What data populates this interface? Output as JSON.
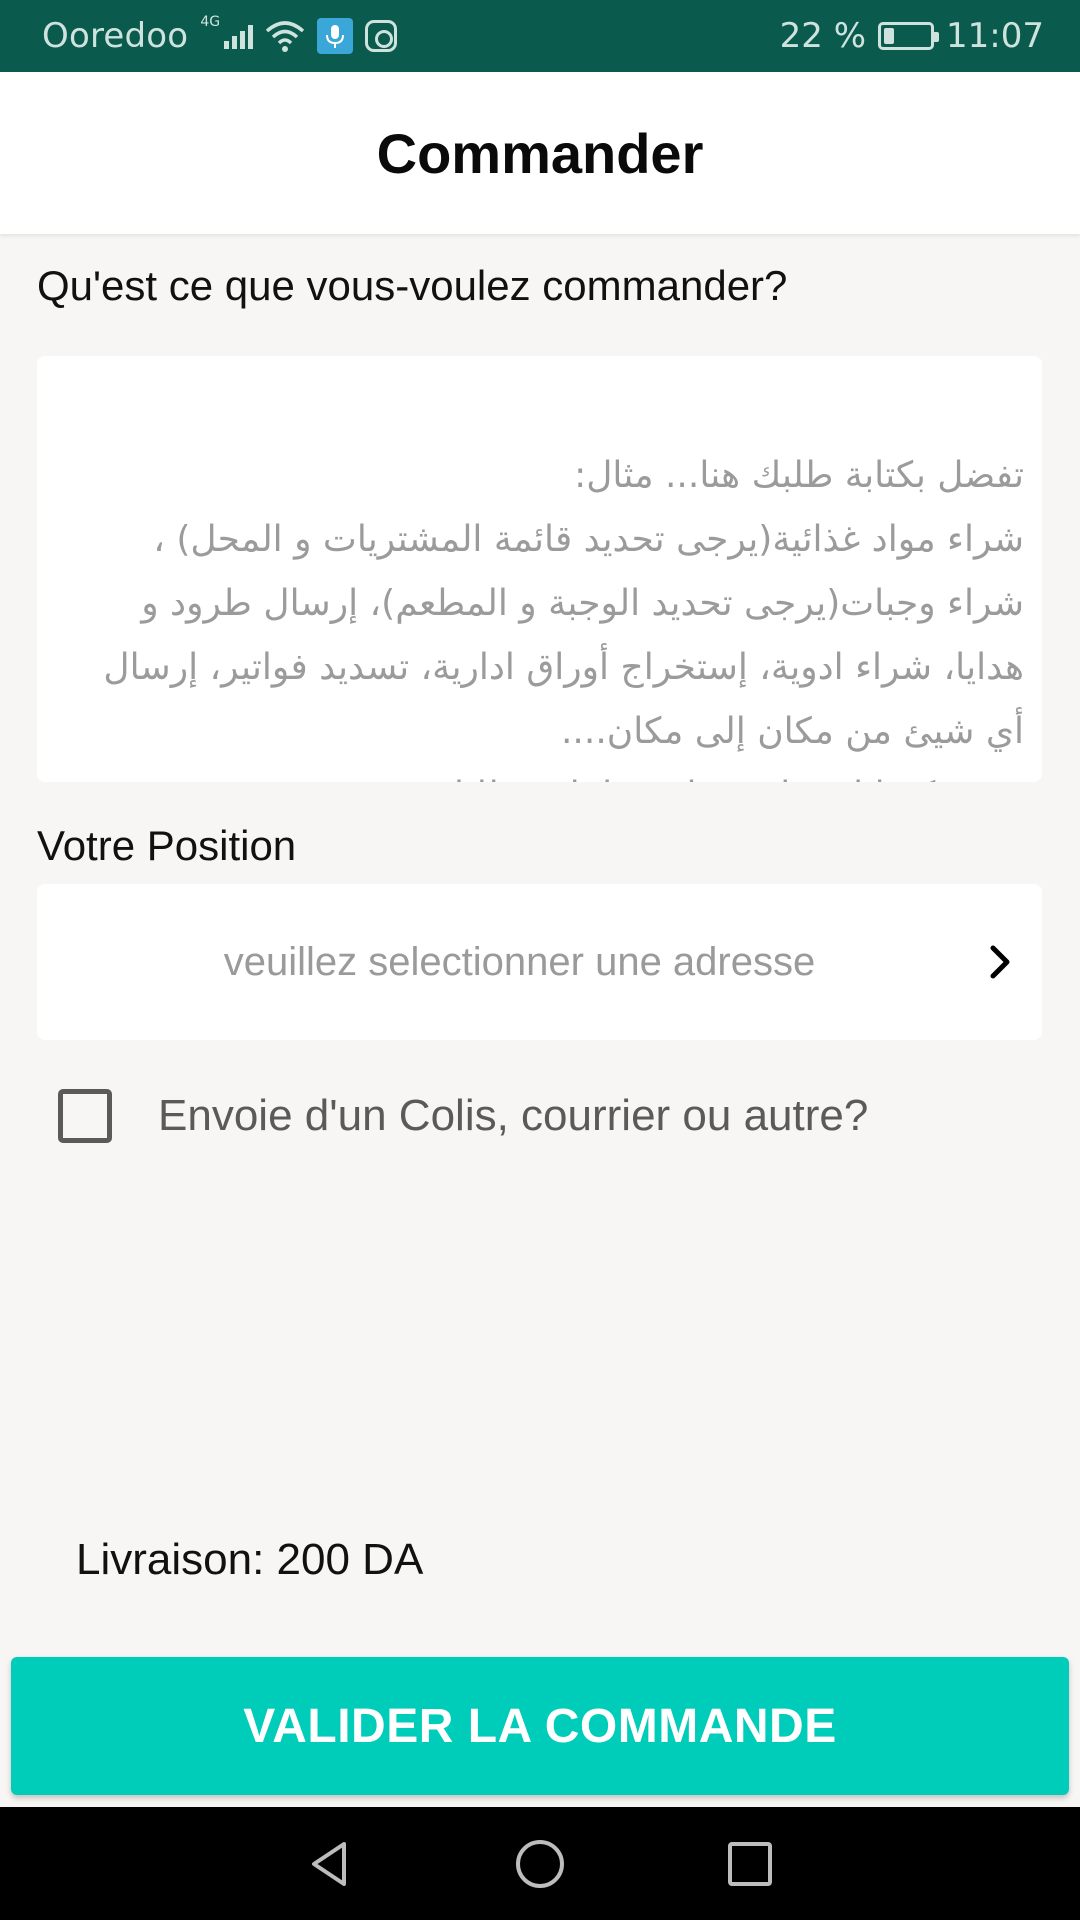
{
  "status_bar": {
    "carrier": "Ooredoo",
    "network_type": "4G",
    "battery_percent_text": "22 %",
    "battery_level": 0.22,
    "time": "11:07",
    "icons": [
      "signal-icon",
      "wifi-icon",
      "voice-recorder-icon",
      "instagram-icon",
      "battery-icon"
    ]
  },
  "header": {
    "title": "Commander"
  },
  "order": {
    "label": "Qu'est ce que vous-voulez commander?",
    "placeholder": "تفضل بكتابة طلبك هنا... مثال:\nشراء مواد غذائية(يرجى تحديد قائمة المشتريات و المحل) ، شراء وجبات(يرجى تحديد الوجبة و المطعم)، إرسال طرود و هدايا، شراء ادوية، إستخراج أوراق ادارية، تسديد فواتير، إرسال أي شيئ من مكان إلى مكان....\nتقدر تكتبنا اي حاجة هنا و حنا نلبي طلبك."
  },
  "position": {
    "label": "Votre Position",
    "placeholder": "veuillez selectionner une adresse"
  },
  "parcel_checkbox": {
    "label": "Envoie d'un Colis, courrier ou autre?",
    "checked": false
  },
  "delivery": {
    "text": "Livraison: 200 DA"
  },
  "submit": {
    "label": "VALIDER LA COMMANDE"
  },
  "nav": {
    "buttons": [
      "back-icon",
      "home-icon",
      "recents-icon"
    ]
  },
  "colors": {
    "status_bar": "#0b5a4e",
    "accent": "#00cdb9",
    "background": "#f7f6f4"
  }
}
